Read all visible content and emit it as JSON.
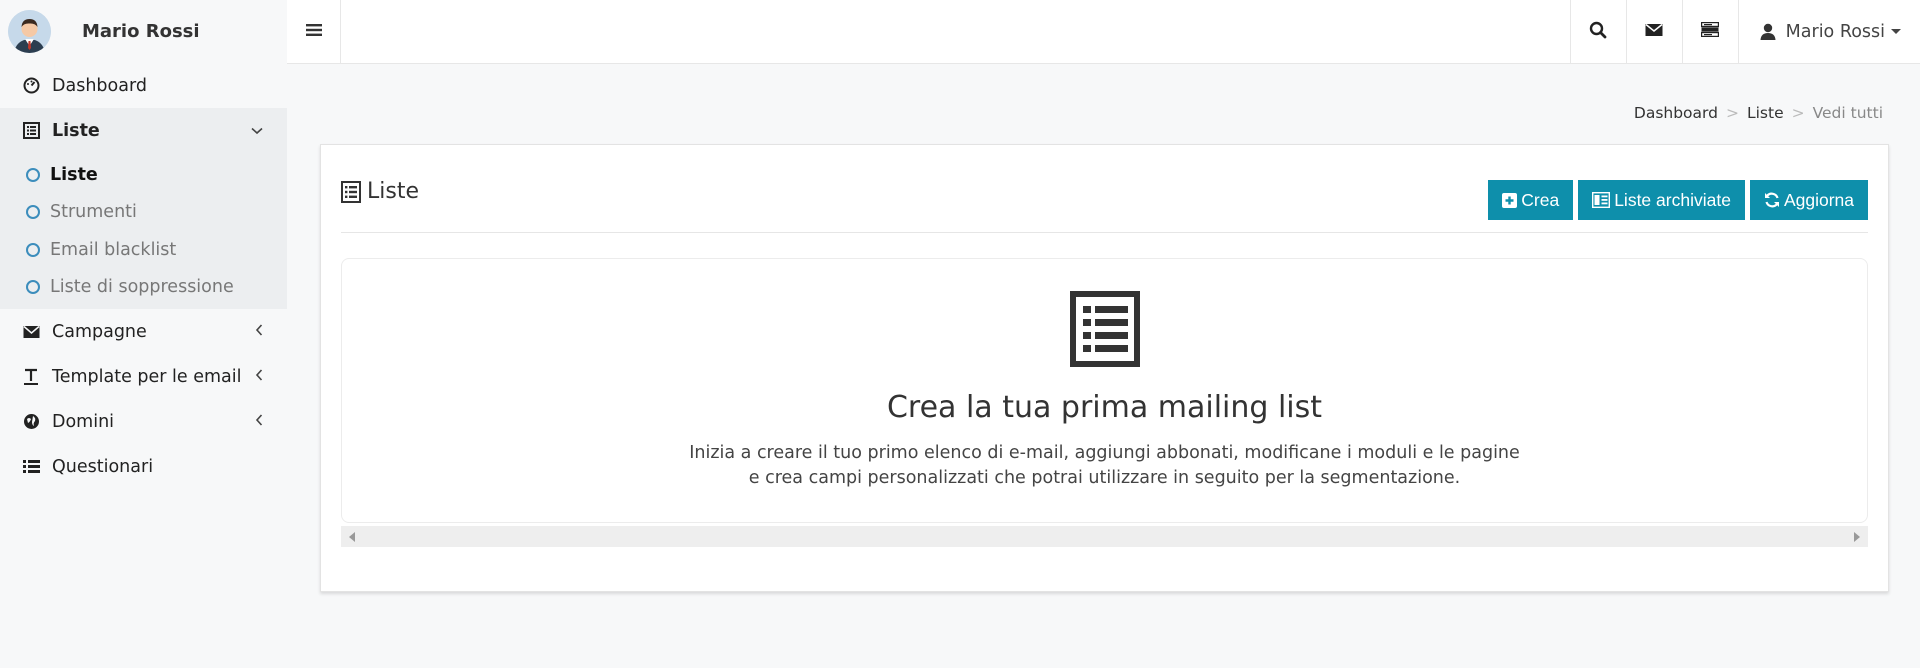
{
  "user": {
    "name": "Mario Rossi"
  },
  "sidebar": {
    "items": [
      {
        "label": "Dashboard",
        "icon": "dashboard-icon"
      },
      {
        "label": "Liste",
        "icon": "list-icon",
        "open": true,
        "children": [
          {
            "label": "Liste",
            "active": true
          },
          {
            "label": "Strumenti"
          },
          {
            "label": "Email blacklist"
          },
          {
            "label": "Liste di soppressione"
          }
        ]
      },
      {
        "label": "Campagne",
        "icon": "envelope-icon"
      },
      {
        "label": "Template per le email",
        "icon": "text-icon"
      },
      {
        "label": "Domini",
        "icon": "globe-icon"
      },
      {
        "label": "Questionari",
        "icon": "list-ul-icon"
      }
    ]
  },
  "topbar": {
    "user_name": "Mario Rossi"
  },
  "breadcrumb": [
    "Dashboard",
    "Liste",
    "Vedi tutti"
  ],
  "card": {
    "title": "Liste",
    "buttons": {
      "create": "Crea",
      "archived": "Liste archiviate",
      "refresh": "Aggiorna"
    },
    "empty": {
      "title": "Crea la tua prima mailing list",
      "line1": "Inizia a creare il tuo primo elenco di e-mail, aggiungi abbonati, modificane i moduli e le pagine",
      "line2": "e crea campi personalizzati che potrai utilizzare in seguito per la segmentazione."
    }
  },
  "colors": {
    "accent": "#0e8fab",
    "sub_circle": "#3c8dbc"
  }
}
